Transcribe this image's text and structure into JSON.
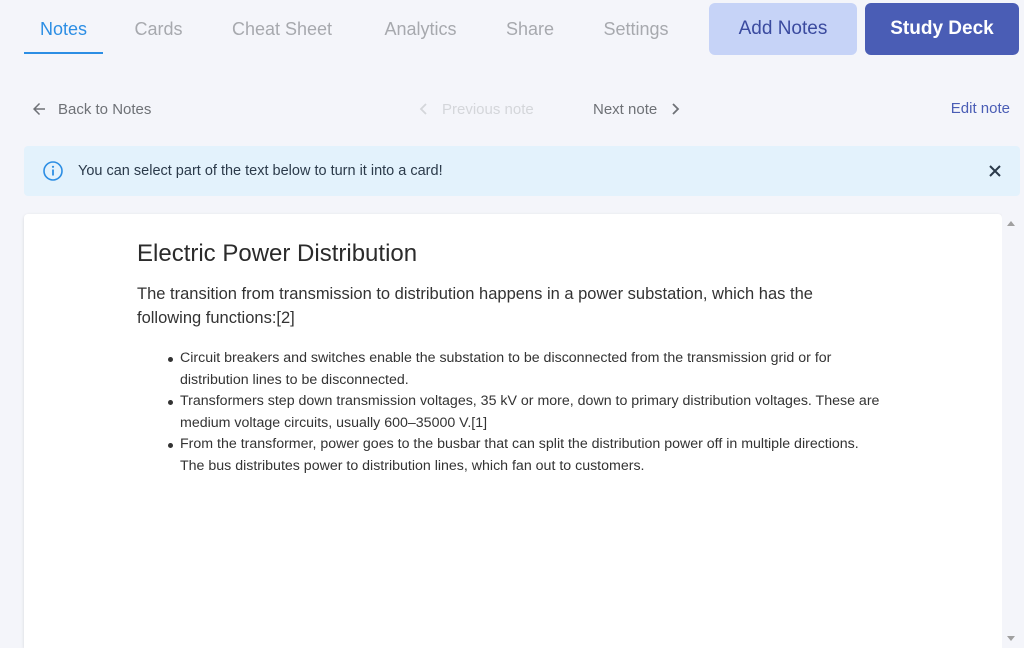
{
  "tabs": [
    {
      "label": "Notes",
      "active": true
    },
    {
      "label": "Cards",
      "active": false
    },
    {
      "label": "Cheat Sheet",
      "active": false
    },
    {
      "label": "Analytics",
      "active": false
    },
    {
      "label": "Share",
      "active": false
    },
    {
      "label": "Settings",
      "active": false
    }
  ],
  "actions": {
    "add_notes": "Add Notes",
    "study_deck": "Study Deck"
  },
  "subnav": {
    "back": "Back to Notes",
    "previous": "Previous note",
    "next": "Next note",
    "edit": "Edit note"
  },
  "banner": {
    "text": "You can select part of the text below to turn it into a card!",
    "icon": "info-icon"
  },
  "note": {
    "title": "Electric Power Distribution",
    "intro": "The transition from transmission to distribution happens in a power substation, which has the following functions:[2]",
    "bullets": [
      "Circuit breakers and switches enable the substation to be disconnected from the transmission grid or for distribution lines to be disconnected.",
      "Transformers step down transmission voltages, 35 kV or more, down to primary distribution voltages. These are medium voltage circuits, usually 600–35000 V.[1]",
      "From the transformer, power goes to the busbar that can split the distribution power off in multiple directions. The bus distributes power to distribution lines, which fan out to customers."
    ]
  },
  "colors": {
    "accent": "#2c8ee4",
    "primary": "#4a5db5",
    "secondary_button": "#c6d3f7",
    "banner_bg": "#e3f2fc"
  }
}
